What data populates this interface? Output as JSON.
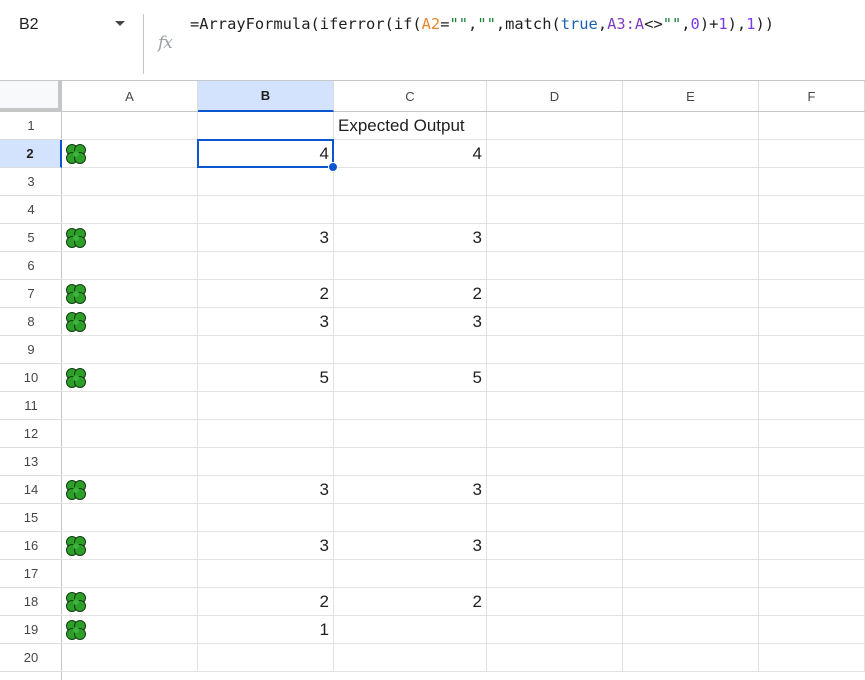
{
  "name_box": {
    "value": "B2"
  },
  "formula_bar": {
    "fx_label": "fx",
    "tokens": [
      {
        "text": "=ArrayFormula(iferror(if(",
        "kind": "plain"
      },
      {
        "text": "A2",
        "kind": "ref"
      },
      {
        "text": "=",
        "kind": "plain"
      },
      {
        "text": "\"\"",
        "kind": "str"
      },
      {
        "text": ",",
        "kind": "plain"
      },
      {
        "text": "\"\"",
        "kind": "str"
      },
      {
        "text": ",match(",
        "kind": "plain"
      },
      {
        "text": "true",
        "kind": "kw"
      },
      {
        "text": ",",
        "kind": "plain"
      },
      {
        "text": "A3:A",
        "kind": "ref2"
      },
      {
        "text": "<>",
        "kind": "plain"
      },
      {
        "text": "\"\"",
        "kind": "str"
      },
      {
        "text": ",",
        "kind": "plain"
      },
      {
        "text": "0",
        "kind": "num"
      },
      {
        "text": ")+",
        "kind": "plain"
      },
      {
        "text": "1",
        "kind": "num"
      },
      {
        "text": "),",
        "kind": "plain"
      },
      {
        "text": "1",
        "kind": "num"
      },
      {
        "text": "))",
        "kind": "plain"
      }
    ]
  },
  "columns": [
    "A",
    "B",
    "C",
    "D",
    "E",
    "F"
  ],
  "active_column": "B",
  "rows": [
    "1",
    "2",
    "3",
    "4",
    "5",
    "6",
    "7",
    "8",
    "9",
    "10",
    "11",
    "12",
    "13",
    "14",
    "15",
    "16",
    "17",
    "18",
    "19",
    "20"
  ],
  "active_row": "2",
  "emoji_name": "four-leaf-clover-icon",
  "cells": {
    "C1": "Expected Output",
    "B2": "4",
    "C2": "4",
    "B5": "3",
    "C5": "3",
    "B7": "2",
    "C7": "2",
    "B8": "3",
    "C8": "3",
    "B10": "5",
    "C10": "5",
    "B14": "3",
    "C14": "3",
    "B16": "3",
    "C16": "3",
    "B18": "2",
    "C18": "2",
    "B19": "1"
  },
  "clover_rows": [
    "2",
    "5",
    "7",
    "8",
    "10",
    "14",
    "16",
    "18",
    "19"
  ],
  "selected_cell": "B2",
  "colors": {
    "selection": "#0b57d0",
    "header_highlight": "#d3e3fd",
    "clover_leaf": "#2e9e2a"
  }
}
